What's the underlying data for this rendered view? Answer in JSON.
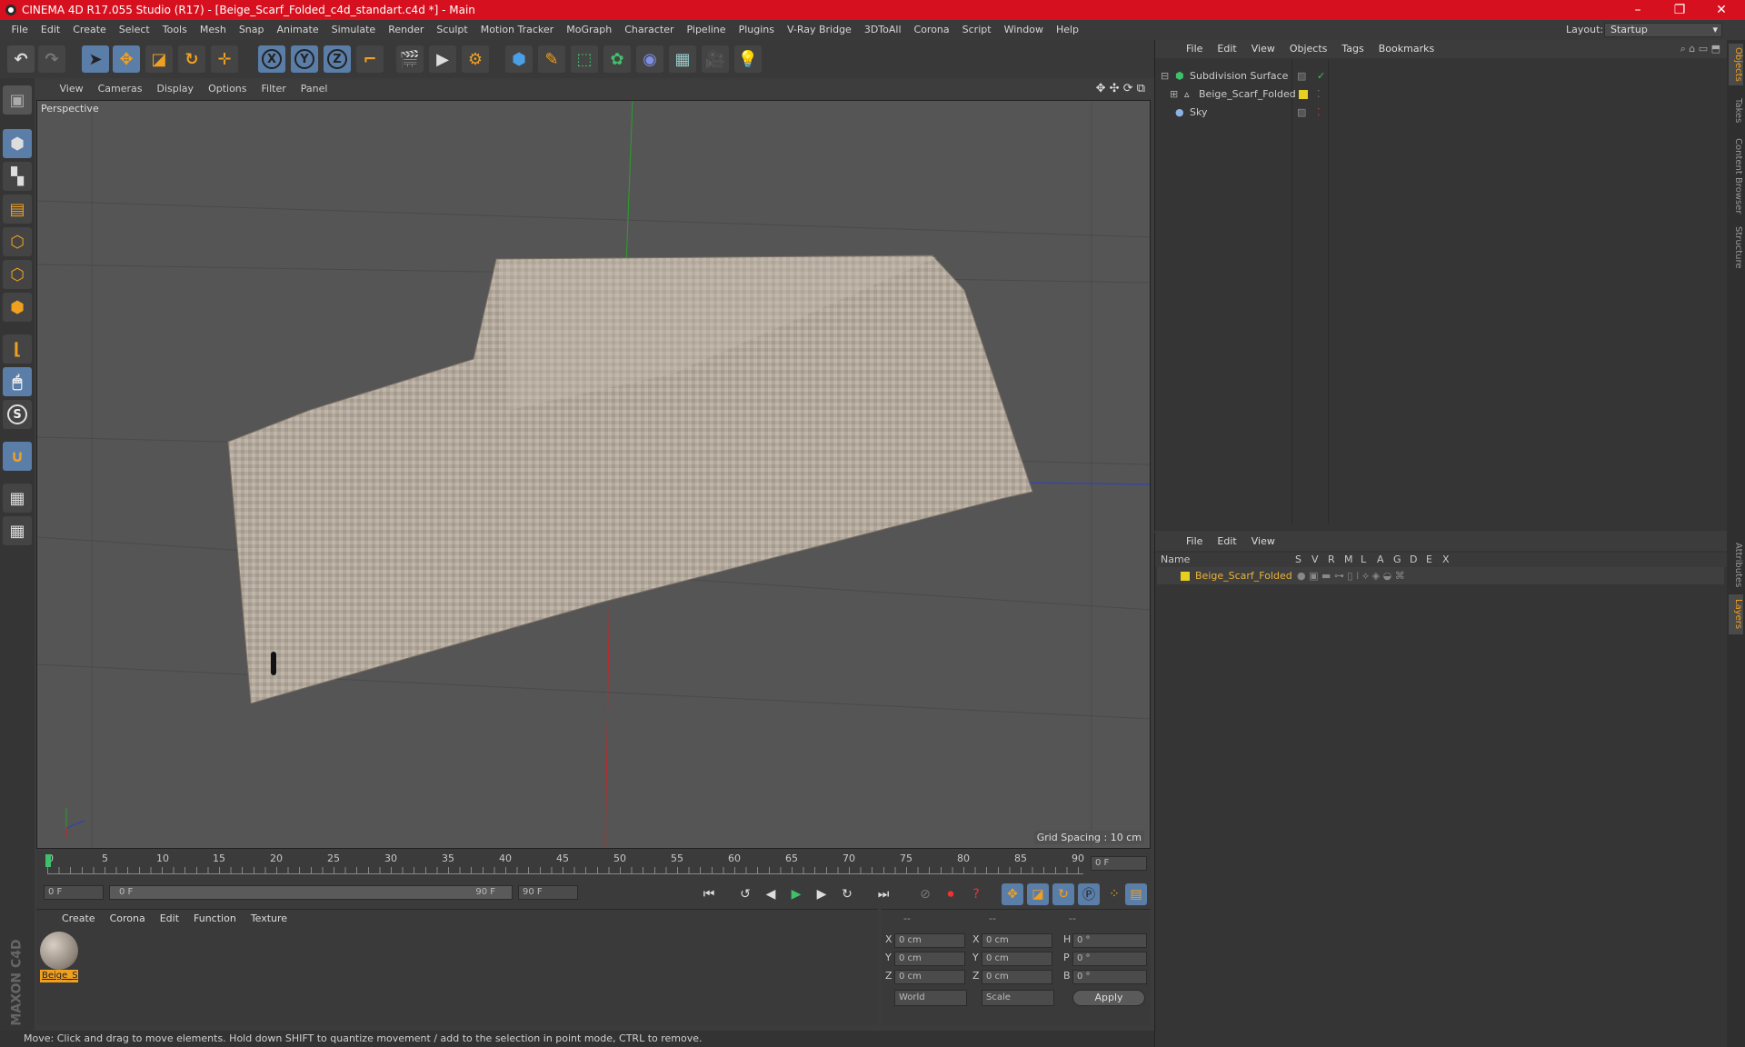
{
  "window": {
    "title": "CINEMA 4D R17.055 Studio (R17) - [Beige_Scarf_Folded_c4d_standart.c4d *] - Main",
    "controls": [
      "–",
      "❐",
      "✕"
    ]
  },
  "menubar": {
    "items": [
      "File",
      "Edit",
      "Create",
      "Select",
      "Tools",
      "Mesh",
      "Snap",
      "Animate",
      "Simulate",
      "Render",
      "Sculpt",
      "Motion Tracker",
      "MoGraph",
      "Character",
      "Pipeline",
      "Plugins",
      "V-Ray Bridge",
      "3DToAll",
      "Corona",
      "Script",
      "Window",
      "Help"
    ],
    "layout_label": "Layout:",
    "layout_value": "Startup"
  },
  "toolbar": {
    "icons": [
      "undo-icon",
      "redo-icon",
      "select-pointer-icon",
      "move-icon",
      "scale-icon",
      "rotate-icon",
      "live-select-icon",
      "x-axis-icon",
      "y-axis-icon",
      "z-axis-icon",
      "coord-system-icon",
      "render-view-icon",
      "render-picture-viewer-icon",
      "edit-render-settings-icon",
      "cube-icon",
      "pen-spline-icon",
      "subdivision-icon",
      "array-icon",
      "deformer-icon",
      "floor-icon",
      "camera-icon",
      "light-icon"
    ],
    "axis_x": "X",
    "axis_y": "Y",
    "axis_z": "Z"
  },
  "lefttools": {
    "icons": [
      "make-editable-icon",
      "model-mode-icon",
      "texture-mode-icon",
      "workplane-icon",
      "points-mode-icon",
      "edges-mode-icon",
      "polygons-mode-icon",
      "enable-axis-icon",
      "tweak-icon",
      "solo-icon",
      "snap-icon",
      "locked-workplane-icon",
      "planar-workplane-icon"
    ],
    "solo_glyph": "S"
  },
  "viewport": {
    "menu": [
      "View",
      "Cameras",
      "Display",
      "Options",
      "Filter",
      "Panel"
    ],
    "label": "Perspective",
    "grid_spacing": "Grid Spacing : 10 cm"
  },
  "timeline": {
    "ticks": [
      "0",
      "5",
      "10",
      "15",
      "20",
      "25",
      "30",
      "35",
      "40",
      "45",
      "50",
      "55",
      "60",
      "65",
      "70",
      "75",
      "80",
      "85",
      "90"
    ],
    "current_frame": "0 F"
  },
  "transport": {
    "start_field": "0 F",
    "range_start": "0 F",
    "range_end": "90 F",
    "end_field": "90 F"
  },
  "materials": {
    "menu": [
      "Create",
      "Corona",
      "Edit",
      "Function",
      "Texture"
    ],
    "items": [
      {
        "label": "Beige_S"
      }
    ]
  },
  "coords": {
    "headers": [
      "--",
      "--",
      "--"
    ],
    "rows": [
      {
        "a": "X",
        "av": "0 cm",
        "b": "X",
        "bv": "0 cm",
        "c": "H",
        "cv": "0 °"
      },
      {
        "a": "Y",
        "av": "0 cm",
        "b": "Y",
        "bv": "0 cm",
        "c": "P",
        "cv": "0 °"
      },
      {
        "a": "Z",
        "av": "0 cm",
        "b": "Z",
        "bv": "0 cm",
        "c": "B",
        "cv": "0 °"
      }
    ],
    "mode1": "World",
    "mode2": "Scale",
    "apply": "Apply"
  },
  "status": {
    "text": "Move: Click and drag to move elements. Hold down SHIFT to quantize movement / add to the selection in point mode, CTRL to remove."
  },
  "objects": {
    "menu": [
      "File",
      "Edit",
      "View",
      "Objects",
      "Tags",
      "Bookmarks"
    ],
    "items": [
      {
        "name": "Subdivision Surface"
      },
      {
        "name": "Beige_Scarf_Folded"
      },
      {
        "name": "Sky"
      }
    ]
  },
  "layers": {
    "menu": [
      "File",
      "Edit",
      "View"
    ],
    "col_name": "Name",
    "cols": [
      "S",
      "V",
      "R",
      "M",
      "L",
      "A",
      "G",
      "D",
      "E",
      "X"
    ],
    "items": [
      {
        "name": "Beige_Scarf_Folded"
      }
    ]
  },
  "sidetabs": [
    "Objects",
    "Takes",
    "Content Browser",
    "Structure",
    "Attributes",
    "Layers"
  ],
  "colors": {
    "title_bar": "#d7101f",
    "accent": "#f0a020",
    "layer_name": "#e8b23a"
  }
}
